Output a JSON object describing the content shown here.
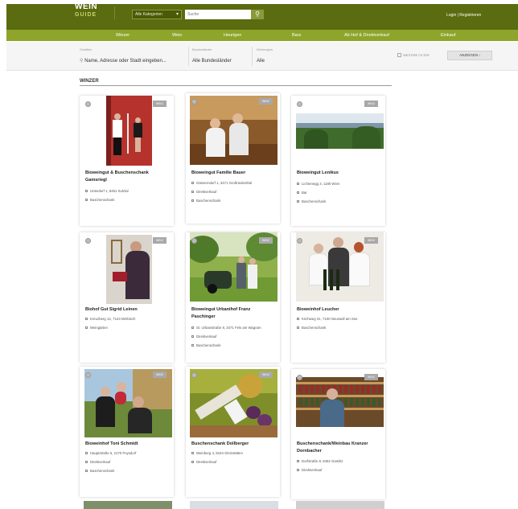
{
  "header": {
    "logo_line1": "WEIN",
    "logo_line2": "GUIDE",
    "category_select": "Alle Kategorien",
    "search_placeholder": "Suche",
    "login_label": "Login | Registrieren"
  },
  "nav": {
    "items": [
      "Winzer",
      "Wein",
      "Heurigen",
      "Bars",
      "Ab Hof & Direktverkauf",
      "Einkauf"
    ]
  },
  "filters": {
    "location_label": "Ortsfilter",
    "location_placeholder": "Name, Adresse oder Stadt eingeben...",
    "state_label": "Bundesländer",
    "state_value": "Alle Bundesländer",
    "region_label": "Weinregion",
    "region_value": "Alle",
    "more_filters": "WEITERE FILTER",
    "submit": "ANZEIGEN"
  },
  "section": {
    "title": "WINZER"
  },
  "cards": [
    {
      "name": "Bioweingut & Buschenschank Gamsriegl",
      "badge": "WINZ",
      "details": [
        "Unterdorf 1, 8461 Sulztal",
        "Buschenschank"
      ]
    },
    {
      "name": "Bioweingut Familie Bauer",
      "badge": "WINZ",
      "details": [
        "Gänserndorf 1, 3471 Großriedenthal",
        "Direktverkauf",
        "Buschenschank"
      ]
    },
    {
      "name": "Bioweingut Lenikus",
      "badge": "WINZ",
      "details": [
        "Lichtenegg 3, 1180 Wien",
        "Bar",
        "Buschenschank"
      ]
    },
    {
      "name": "Biohof Gut Sigrid Leinen",
      "badge": "WINZ",
      "details": [
        "Kreuzberg 12, 7123 Mörbisch",
        "Weingärten"
      ]
    },
    {
      "name": "Bioweingut Urbanihof Franz Paschinger",
      "badge": "WINZ",
      "details": [
        "St. Urbanistraße 8, 3471 Fels am Wagram",
        "Direktverkauf",
        "Buschenschank"
      ]
    },
    {
      "name": "Bioweinhof Leucher",
      "badge": "WINZ",
      "details": [
        "Kirchweg 31, 7100 Neusiedl am See",
        "Buschenschank"
      ]
    },
    {
      "name": "Bioweinhof Toni Schmidt",
      "badge": "WINZ",
      "details": [
        "Hauptstraße 5, 2170 Poysdorf",
        "Direktverkauf",
        "Buschenschank"
      ]
    },
    {
      "name": "Buschenschank Dollberger",
      "badge": "WINZ",
      "details": [
        "Weinberg 4, 8443 Gleinstätten",
        "Direktverkauf"
      ]
    },
    {
      "name": "Buschenschank/Weinbau Kranzer Dornbacher",
      "badge": "WINZ",
      "details": [
        "Dorfstraße 8, 8462 Gamlitz",
        "Direktverkauf"
      ]
    }
  ]
}
